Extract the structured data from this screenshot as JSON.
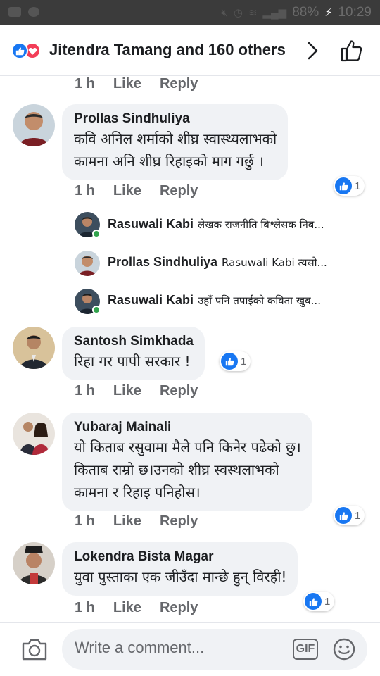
{
  "status_bar": {
    "battery": "88%",
    "time": "10:29"
  },
  "header": {
    "title": "Jitendra Tamang and 160 others"
  },
  "actions": {
    "time": "1 h",
    "like": "Like",
    "reply": "Reply"
  },
  "comments": [
    {
      "author": "Prollas Sindhuliya",
      "lines": [
        "कवि अनिल शर्माको शीघ्र स्वास्थ्यलाभको",
        "कामना अनि शीघ्र रिहाइको माग गर्छु ।"
      ],
      "reactions": "1",
      "replies": [
        {
          "author": "Rasuwali Kabi",
          "preview": "लेखक राजनीति बिश्लेसक निब..."
        },
        {
          "author": "Prollas Sindhuliya",
          "preview": "Rasuwali Kabi त्यसो..."
        },
        {
          "author": "Rasuwali Kabi",
          "preview": "उहाँ पनि तपाईंको कविता खुब..."
        }
      ]
    },
    {
      "author": "Santosh Simkhada",
      "lines": [
        "रिहा गर पापी सरकार !"
      ],
      "reactions": "1"
    },
    {
      "author": "Yubaraj Mainali",
      "lines": [
        "यो किताब रसुवामा मैले पनि किनेर पढेको छु।",
        "किताब राम्रो छ।उनको शीघ्र स्वस्थलाभको",
        "कामना र रिहाइ पनिहोस।"
      ],
      "reactions": "1"
    },
    {
      "author": "Lokendra Bista Magar",
      "lines": [
        "युवा पुस्ताका एक जीउँदा मान्छे हुन् विरही!"
      ],
      "reactions": "1"
    }
  ],
  "composer": {
    "placeholder": "Write a comment...",
    "gif_label": "GIF"
  },
  "colors": {
    "accent": "#1877f2",
    "love": "#f33e58",
    "bubble": "#f0f2f5",
    "meta": "#65676b",
    "online": "#31a24c"
  }
}
